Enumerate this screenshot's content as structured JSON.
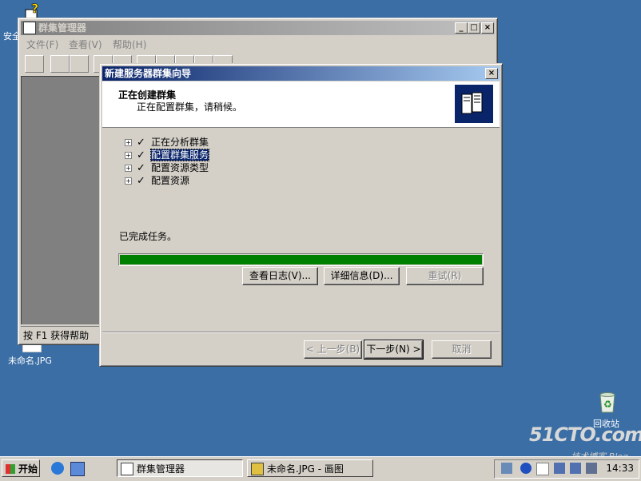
{
  "desktop": {
    "icons": [
      {
        "label": "安全"
      },
      {
        "label": "未命名.JPG"
      },
      {
        "label": "回收站"
      }
    ],
    "watermark": {
      "brand": "51CTO.com",
      "sub": "技术博客 Blog"
    }
  },
  "cluster_window": {
    "title": "群集管理器",
    "menu": [
      "文件(F)",
      "查看(V)",
      "帮助(H)"
    ],
    "status": "按 F1 获得帮助"
  },
  "wizard": {
    "title": "新建服务器群集向导",
    "header_title": "正在创建群集",
    "header_subtitle": "正在配置群集，请稍候。",
    "tasks": [
      {
        "label": "正在分析群集",
        "selected": false
      },
      {
        "label": "配置群集服务",
        "selected": true
      },
      {
        "label": "配置资源类型",
        "selected": false
      },
      {
        "label": "配置资源",
        "selected": false
      }
    ],
    "status_text": "已完成任务。",
    "progress": 1.0,
    "progress_color": "#008000",
    "buttons": {
      "view_log": "查看日志(V)...",
      "details": "详细信息(D)...",
      "retry": "重试(R)",
      "back": "< 上一步(B)",
      "next": "下一步(N) >",
      "cancel": "取消"
    }
  },
  "taskbar": {
    "start_label": "开始",
    "tasks": [
      {
        "label": "群集管理器"
      },
      {
        "label": "未命名.JPG - 画图"
      }
    ],
    "clock": "14:33"
  },
  "colors": {
    "desktop": "#3a6ea5",
    "active_title": "#0a246a",
    "face": "#d4d0c8"
  }
}
